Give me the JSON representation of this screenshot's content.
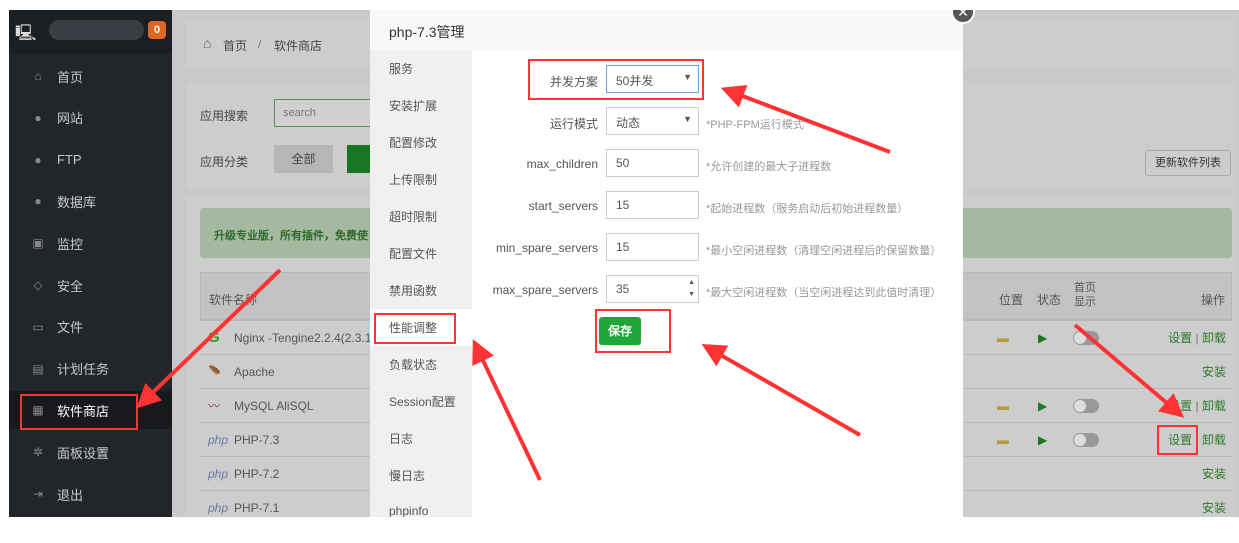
{
  "sidebar": {
    "badge": "0",
    "items": [
      {
        "label": "首页",
        "icon": "home-icon",
        "glyph": "⌂"
      },
      {
        "label": "网站",
        "icon": "globe-icon",
        "glyph": "●"
      },
      {
        "label": "FTP",
        "icon": "ftp-icon",
        "glyph": "●"
      },
      {
        "label": "数据库",
        "icon": "database-icon",
        "glyph": "●"
      },
      {
        "label": "监控",
        "icon": "monitor-icon",
        "glyph": "▣"
      },
      {
        "label": "安全",
        "icon": "shield-icon",
        "glyph": "◇"
      },
      {
        "label": "文件",
        "icon": "folder-icon",
        "glyph": "▭"
      },
      {
        "label": "计划任务",
        "icon": "calendar-icon",
        "glyph": "▤"
      },
      {
        "label": "软件商店",
        "icon": "grid-icon",
        "glyph": "▦"
      },
      {
        "label": "面板设置",
        "icon": "gear-icon",
        "glyph": "✲"
      },
      {
        "label": "退出",
        "icon": "logout-icon",
        "glyph": "⇥"
      }
    ]
  },
  "breadcrumb": {
    "home": "首页",
    "sep": "/",
    "current": "软件商店"
  },
  "search": {
    "label": "应用搜索",
    "placeholder": "search"
  },
  "category": {
    "label": "应用分类",
    "all": "全部"
  },
  "update_button": "更新软件列表",
  "promo": "升级专业版，所有插件，免费使",
  "table": {
    "headers": {
      "name": "软件名称",
      "location": "位置",
      "status": "状态",
      "homepage": "首页显示",
      "actions": "操作"
    },
    "rows": [
      {
        "name": "Nginx -Tengine2.2.4(2.3.1",
        "logo": "G",
        "installed": true,
        "actions": [
          "设置",
          "卸载"
        ]
      },
      {
        "name": "Apache",
        "logo": "🪶",
        "installed": false,
        "actions": [
          "安装"
        ]
      },
      {
        "name": "MySQL AliSQL",
        "logo": "〰",
        "installed": true,
        "actions": [
          "设置",
          "卸载"
        ]
      },
      {
        "name": "PHP-7.3",
        "logo": "php",
        "installed": true,
        "actions": [
          "设置",
          "卸载"
        ]
      },
      {
        "name": "PHP-7.2",
        "logo": "php",
        "installed": false,
        "actions": [
          "安装"
        ]
      },
      {
        "name": "PHP-7.1",
        "logo": "php",
        "installed": false,
        "actions": [
          "安装"
        ]
      }
    ]
  },
  "modal": {
    "title": "php-7.3管理",
    "menu": [
      "服务",
      "安装扩展",
      "配置修改",
      "上传限制",
      "超时限制",
      "配置文件",
      "禁用函数",
      "性能调整",
      "负载状态",
      "Session配置",
      "日志",
      "慢日志",
      "phpinfo"
    ],
    "active": "性能调整",
    "form": [
      {
        "label": "并发方案",
        "value": "50并发",
        "type": "select",
        "hint": ""
      },
      {
        "label": "运行模式",
        "value": "动态",
        "type": "select",
        "hint": "*PHP-FPM运行模式"
      },
      {
        "label": "max_children",
        "value": "50",
        "type": "input",
        "hint": "*允许创建的最大子进程数"
      },
      {
        "label": "start_servers",
        "value": "15",
        "type": "input",
        "hint": "*起始进程数（服务启动后初始进程数量）"
      },
      {
        "label": "min_spare_servers",
        "value": "15",
        "type": "input",
        "hint": "*最小空闲进程数（清理空闲进程后的保留数量）"
      },
      {
        "label": "max_spare_servers",
        "value": "35",
        "type": "number",
        "hint": "*最大空闲进程数（当空闲进程达到此值时清理）"
      }
    ],
    "save": "保存"
  },
  "colors": {
    "accent": "#20a53a",
    "annotation": "#ff3333"
  }
}
